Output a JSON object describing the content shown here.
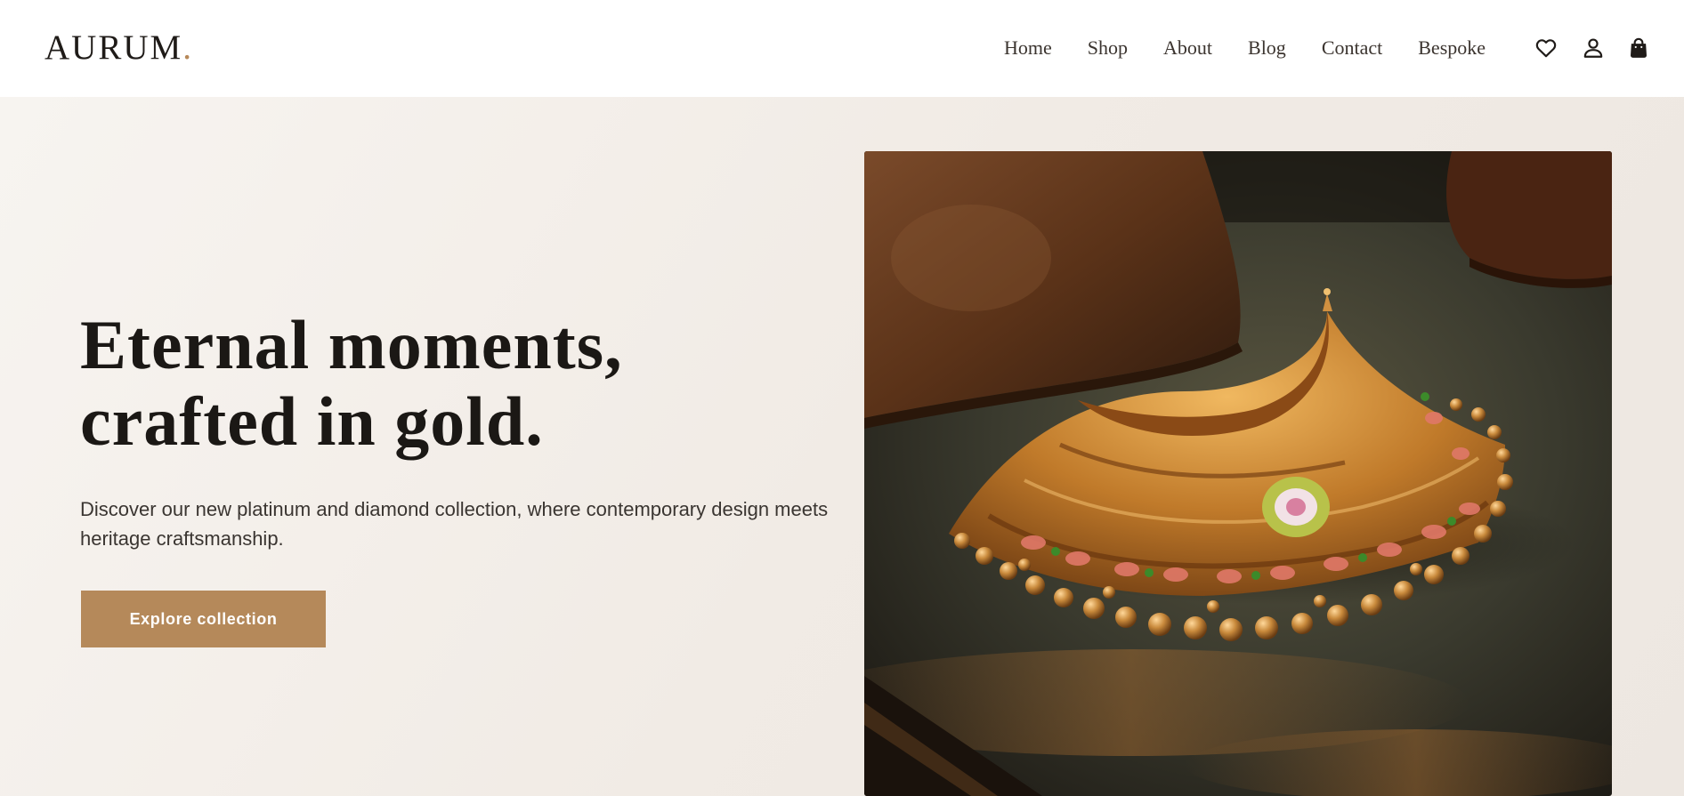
{
  "brand": {
    "name": "AURUM",
    "dot": ".",
    "accent_color": "#b5895a"
  },
  "nav": {
    "items": [
      {
        "label": "Home"
      },
      {
        "label": "Shop"
      },
      {
        "label": "About"
      },
      {
        "label": "Blog"
      },
      {
        "label": "Contact"
      },
      {
        "label": "Bespoke"
      }
    ]
  },
  "header_icons": {
    "wishlist": "heart-icon",
    "account": "user-icon",
    "cart": "shopping-bag-icon"
  },
  "hero": {
    "title_line1": "Eternal moments,",
    "title_line2": "crafted in gold.",
    "subtitle": "Discover our new platinum and diamond collection, where contemporary design meets heritage craftsmanship.",
    "cta_label": "Explore collection",
    "image_alt": "gold-necklace-photo"
  },
  "colors": {
    "text_dark": "#1b1815",
    "background": "#f3eee9",
    "button": "#b5895a"
  }
}
